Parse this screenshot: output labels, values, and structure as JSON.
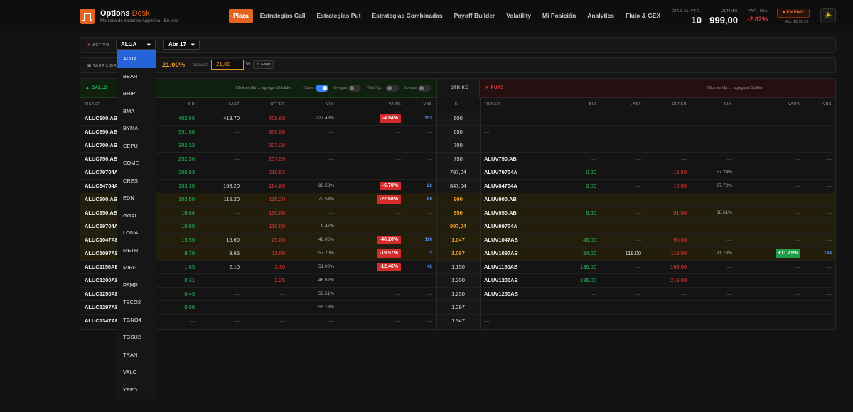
{
  "header": {
    "brand": "Options",
    "brand_accent": "Desk",
    "subtitle": "Mercado de opciones Argentina · En vivo",
    "nav": [
      "Plaza",
      "Estrategias Call",
      "Estrategias Put",
      "Estrategias Combinadas",
      "Payoff Builder",
      "Volatility",
      "Mi Posición",
      "Analytics",
      "Flujo & GEX"
    ],
    "active_nav": "Plaza",
    "days_label": "DÍAS AL VTO.",
    "days_value": "10",
    "last_label": "ÚLTIMO",
    "last_value": "999,00",
    "var_label": "VAR. DÍA",
    "var_value": "-2.82%",
    "live": "● EN VIVO",
    "updated": "Act. 12:55:26",
    "theme_icon": "sun-icon"
  },
  "controls": {
    "activo_label": "ACTIVO",
    "activo_value": "ALUA",
    "expiry_value": "Abr 17",
    "tasa_label": "TASA LIBRE",
    "tasa_value": "21.00%",
    "manual_label": "Manual:",
    "manual_value": "21,00",
    "pct": "%",
    "feed": "↺ Feed"
  },
  "calls": {
    "title": "▲ CALLS",
    "hint": "Click en fila → agrega al Builder",
    "toggles": [
      {
        "label": "Ticker",
        "on": true
      },
      {
        "label": "Griegas",
        "on": false
      },
      {
        "label": "V.Int/Tpo",
        "on": false
      },
      {
        "label": "Spread",
        "on": false
      }
    ],
    "columns": [
      "TICKER",
      "BID",
      "LAST",
      "OFFER",
      "VI%",
      "VAR%",
      "VNS"
    ]
  },
  "strike_title": "STRIKE",
  "strike_col": "K",
  "puts": {
    "title": "▼ PUTS",
    "hint": "Click en fila → agrega al Builder",
    "columns": [
      "TICKER",
      "BID",
      "LAST",
      "OFFER",
      "VI%",
      "VAR%",
      "VNS"
    ]
  },
  "rows": [
    {
      "atm": false,
      "c": [
        "ALUC600.AB",
        "402.66",
        "413.70",
        "406.68",
        "227.48%",
        "-4.94%",
        "153"
      ],
      "k": "600",
      "p": [
        "—",
        "",
        "",
        "",
        "",
        "",
        ""
      ]
    },
    {
      "atm": false,
      "c": [
        "ALUC650.AB",
        "351.68",
        "—",
        "356.98",
        "—",
        "—",
        "—"
      ],
      "k": "650",
      "p": [
        "—",
        "",
        "",
        "",
        "",
        "",
        ""
      ]
    },
    {
      "atm": false,
      "c": [
        "ALUC700.AB",
        "302.12",
        "—",
        "307.28",
        "—",
        "—",
        "—"
      ],
      "k": "700",
      "p": [
        "—",
        "",
        "",
        "",
        "",
        "",
        ""
      ]
    },
    {
      "atm": false,
      "c": [
        "ALUC750.AB",
        "252.56",
        "—",
        "257.59",
        "—",
        "—",
        "—"
      ],
      "k": "750",
      "p": [
        "ALUV750.AB",
        "—",
        "—",
        "—",
        "—",
        "—",
        "—"
      ]
    },
    {
      "atm": false,
      "c": [
        "ALUC79704A",
        "205.93",
        "—",
        "210.83",
        "—",
        "—",
        "—"
      ],
      "k": "797,04",
      "p": [
        "ALUV79704A",
        "0.20",
        "—",
        "15.50",
        "57.24%",
        "—",
        "—"
      ]
    },
    {
      "atm": false,
      "c": [
        "ALUC84704A",
        "153.10",
        "168.20",
        "164.80",
        "98.58%",
        "-6.70%",
        "22"
      ],
      "k": "847,04",
      "p": [
        "ALUV84704A",
        "0.00",
        "—",
        "10.00",
        "27.72%",
        "—",
        "—"
      ]
    },
    {
      "atm": true,
      "c": [
        "ALUC900.AB",
        "103.50",
        "115.20",
        "115.20",
        "72.54%",
        "-22.68%",
        "68"
      ],
      "k": "900",
      "p": [
        "ALUV900.AB",
        "—",
        "—",
        "—",
        "—",
        "—",
        "—"
      ]
    },
    {
      "atm": true,
      "c": [
        "ALUC950.AB",
        "16.64",
        "—",
        "130.00",
        "—",
        "—",
        "—"
      ],
      "k": "950",
      "p": [
        "ALUV950.AB",
        "6.50",
        "—",
        "51.00",
        "38.61%",
        "—",
        "—"
      ]
    },
    {
      "atm": true,
      "c": [
        "ALUC99704A",
        "10.80",
        "—",
        "110.00",
        "9.47%",
        "—",
        "—"
      ],
      "k": "997,04",
      "p": [
        "ALUV99704A",
        "—",
        "—",
        "—",
        "—",
        "—",
        "—"
      ]
    },
    {
      "atm": true,
      "c": [
        "ALUC1047AB",
        "15.55",
        "15.60",
        "25.00",
        "48.05%",
        "-46.20%",
        "110"
      ],
      "k": "1.047",
      "p": [
        "ALUV1047AB",
        "46.00",
        "—",
        "90.00",
        "—",
        "—",
        "—"
      ]
    },
    {
      "atm": true,
      "c": [
        "ALUC1097AB",
        "9.70",
        "9.65",
        "11.00",
        "57.70%",
        "-19.57%",
        "2"
      ],
      "k": "1.097",
      "p": [
        "ALUV1097AB",
        "84.00",
        "119.00",
        "119.00",
        "91.13%",
        "+11.21%",
        "144"
      ]
    },
    {
      "atm": false,
      "c": [
        "ALUC1150AB",
        "1.85",
        "2.10",
        "2.10",
        "51.00%",
        "-12.46%",
        "42"
      ],
      "k": "1.150",
      "p": [
        "ALUV1150AB",
        "136.00",
        "—",
        "168.00",
        "—",
        "—",
        "—"
      ]
    },
    {
      "atm": false,
      "c": [
        "ALUC1200AB",
        "0.31",
        "—",
        "2.25",
        "46.67%",
        "—",
        "—"
      ],
      "k": "1.200",
      "p": [
        "ALUV1200AB",
        "186.00",
        "—",
        "215.00",
        "—",
        "—",
        "—"
      ]
    },
    {
      "atm": false,
      "c": [
        "ALUC1250AB",
        "0.45",
        "—",
        "—",
        "58.51%",
        "—",
        "—"
      ],
      "k": "1.250",
      "p": [
        "ALUV1250AB",
        "—",
        "—",
        "—",
        "—",
        "—",
        "—"
      ]
    },
    {
      "atm": false,
      "c": [
        "ALUC1297AB",
        "0.08",
        "—",
        "—",
        "55.18%",
        "—",
        "—"
      ],
      "k": "1.297",
      "p": [
        "—",
        "",
        "",
        "",
        "",
        "",
        ""
      ]
    },
    {
      "atm": false,
      "c": [
        "ALUC1347AB",
        "—",
        "—",
        "—",
        "—",
        "—",
        "—"
      ],
      "k": "1.347",
      "p": [
        "—",
        "",
        "",
        "",
        "",
        "",
        ""
      ]
    }
  ],
  "dropdown": {
    "options": [
      "ALUA",
      "BBAR",
      "BHIP",
      "BMA",
      "BYMA",
      "CEPU",
      "COME",
      "CRES",
      "EDN",
      "GGAL",
      "LOMA",
      "METR",
      "MIRG",
      "PAMP",
      "TECO2",
      "TGNO4",
      "TGSU2",
      "TRAN",
      "VALO",
      "YPFD"
    ],
    "selected": "ALUA"
  },
  "colors": {
    "accent": "#e5641f",
    "positive": "#27c15b",
    "negative": "#ee3a3a",
    "selected": "#2563d8",
    "atm_row": "#231e0c"
  }
}
